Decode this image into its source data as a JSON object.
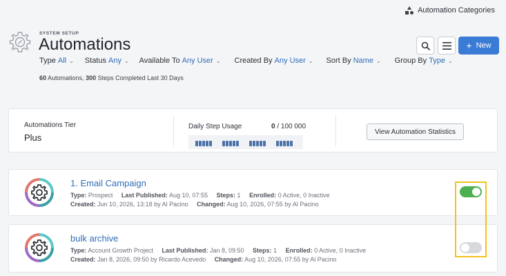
{
  "topbar": {
    "categories_label": "Automation Categories"
  },
  "header": {
    "section": "SYSTEM SETUP",
    "title": "Automations"
  },
  "toolbar": {
    "new_label": "New"
  },
  "filters": [
    {
      "label": "Type",
      "value": "All"
    },
    {
      "label": "Status",
      "value": "Any"
    },
    {
      "label": "Available To",
      "value": "Any User"
    },
    {
      "label": "Created By",
      "value": "Any User"
    },
    {
      "label": "Sort By",
      "value": "Name"
    },
    {
      "label": "Group By",
      "value": "Type"
    }
  ],
  "summary": {
    "automations_count": "60",
    "automations_label": "Automations,",
    "steps_count": "300",
    "steps_label": "Steps Completed Last 30 Days"
  },
  "tier": {
    "label": "Automations Tier",
    "value": "Plus",
    "usage_label": "Daily Step Usage",
    "usage_used": "0",
    "usage_total": "/ 100 000",
    "stats_button": "View Automation Statistics"
  },
  "automations": [
    {
      "name": "1. Email Campaign",
      "type_label": "Type:",
      "type": "Prospect",
      "published_label": "Last Published:",
      "published": "Aug 10, 07:55",
      "steps_label": "Steps:",
      "steps": "1",
      "enrolled_label": "Enrolled:",
      "enrolled": "0 Active, 0 Inactive",
      "created_label": "Created:",
      "created": "Jun 10, 2026, 13:18 by Al Pacino",
      "changed_label": "Changed:",
      "changed": "Aug 10, 2026, 07:55 by Al Pacino",
      "enabled": true
    },
    {
      "name": "bulk archive",
      "type_label": "Type:",
      "type": "Account Growth Project",
      "published_label": "Last Published:",
      "published": "Jan 8, 09:50",
      "steps_label": "Steps:",
      "steps": "1",
      "enrolled_label": "Enrolled:",
      "enrolled": "0 Active, 0 Inactive",
      "created_label": "Created:",
      "created": "Jan 8, 2026, 09:50 by Ricardo Acevedo",
      "changed_label": "Changed:",
      "changed": "Aug 10, 2026, 07:55 by Al Pacino",
      "enabled": false
    }
  ],
  "colors": {
    "accent": "#3a7bd5",
    "link": "#2f6db8",
    "toggle_on": "#4caf50",
    "toggle_off": "#d7d9dc",
    "highlight": "#f3c11b"
  },
  "icons": [
    "categories-icon",
    "gear-icon",
    "search-icon",
    "hamburger-menu-icon",
    "plus-icon",
    "chevron-down-icon",
    "automation-gear-icon"
  ]
}
